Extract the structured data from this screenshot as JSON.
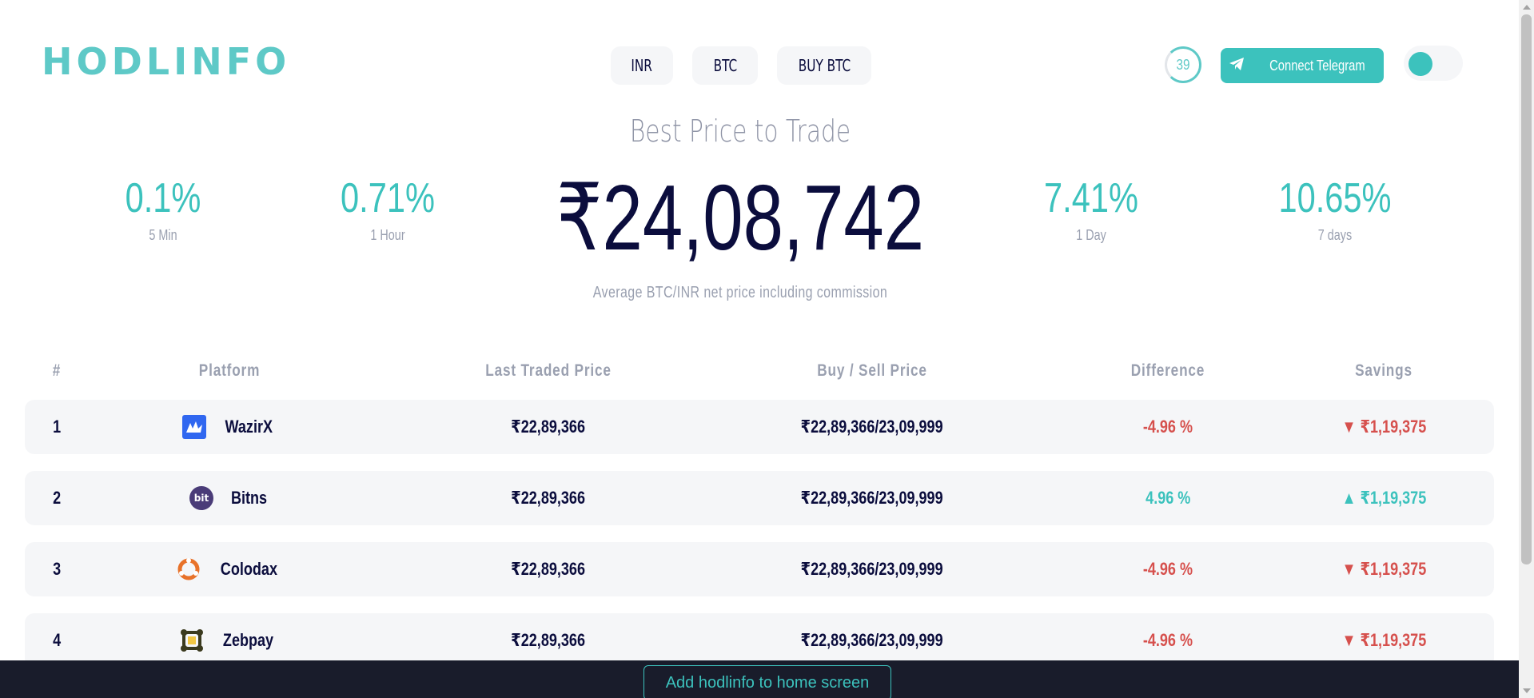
{
  "header": {
    "logo_text": "HODLINFO",
    "nav": [
      "INR",
      "BTC",
      "BUY BTC"
    ],
    "timer_value": "39",
    "telegram_label": "Connect Telegram",
    "telegram_icon": "paper-plane-icon"
  },
  "hero": {
    "title": "Best Price to Trade",
    "price": "₹24,08,742",
    "subtitle": "Average BTC/INR net price including commission",
    "stats": [
      {
        "value": "0.1%",
        "label": "5 Min"
      },
      {
        "value": "0.71%",
        "label": "1 Hour"
      },
      {
        "value": "7.41%",
        "label": "1 Day"
      },
      {
        "value": "10.65%",
        "label": "7 days"
      }
    ]
  },
  "table": {
    "headers": [
      "#",
      "Platform",
      "Last Traded Price",
      "Buy / Sell Price",
      "Difference",
      "Savings"
    ],
    "rows": [
      {
        "rank": "1",
        "platform": "WazirX",
        "icon": "wazirx-icon",
        "last": "₹22,89,366",
        "buysell": "₹22,89,366/23,09,999",
        "diff": "-4.96 %",
        "savings": "▼ ₹1,19,375",
        "trend": "down"
      },
      {
        "rank": "2",
        "platform": "Bitns",
        "icon": "bitns-icon",
        "last": "₹22,89,366",
        "buysell": "₹22,89,366/23,09,999",
        "diff": "4.96 %",
        "savings": "▲ ₹1,19,375",
        "trend": "up"
      },
      {
        "rank": "3",
        "platform": "Colodax",
        "icon": "colodax-icon",
        "last": "₹22,89,366",
        "buysell": "₹22,89,366/23,09,999",
        "diff": "-4.96 %",
        "savings": "▼ ₹1,19,375",
        "trend": "down"
      },
      {
        "rank": "4",
        "platform": "Zebpay",
        "icon": "zebpay-icon",
        "last": "₹22,89,366",
        "buysell": "₹22,89,366/23,09,999",
        "diff": "-4.96 %",
        "savings": "▼ ₹1,19,375",
        "trend": "down"
      }
    ]
  },
  "footer": {
    "add_home_label": "Add hodlinfo to home screen"
  },
  "colors": {
    "accent": "#3cc2bd",
    "negative": "#d6504d",
    "text_dark": "#0b0d3d",
    "muted": "#9aa0b0",
    "row_bg": "#f5f6f8",
    "bottom_bar": "#191c2b"
  }
}
